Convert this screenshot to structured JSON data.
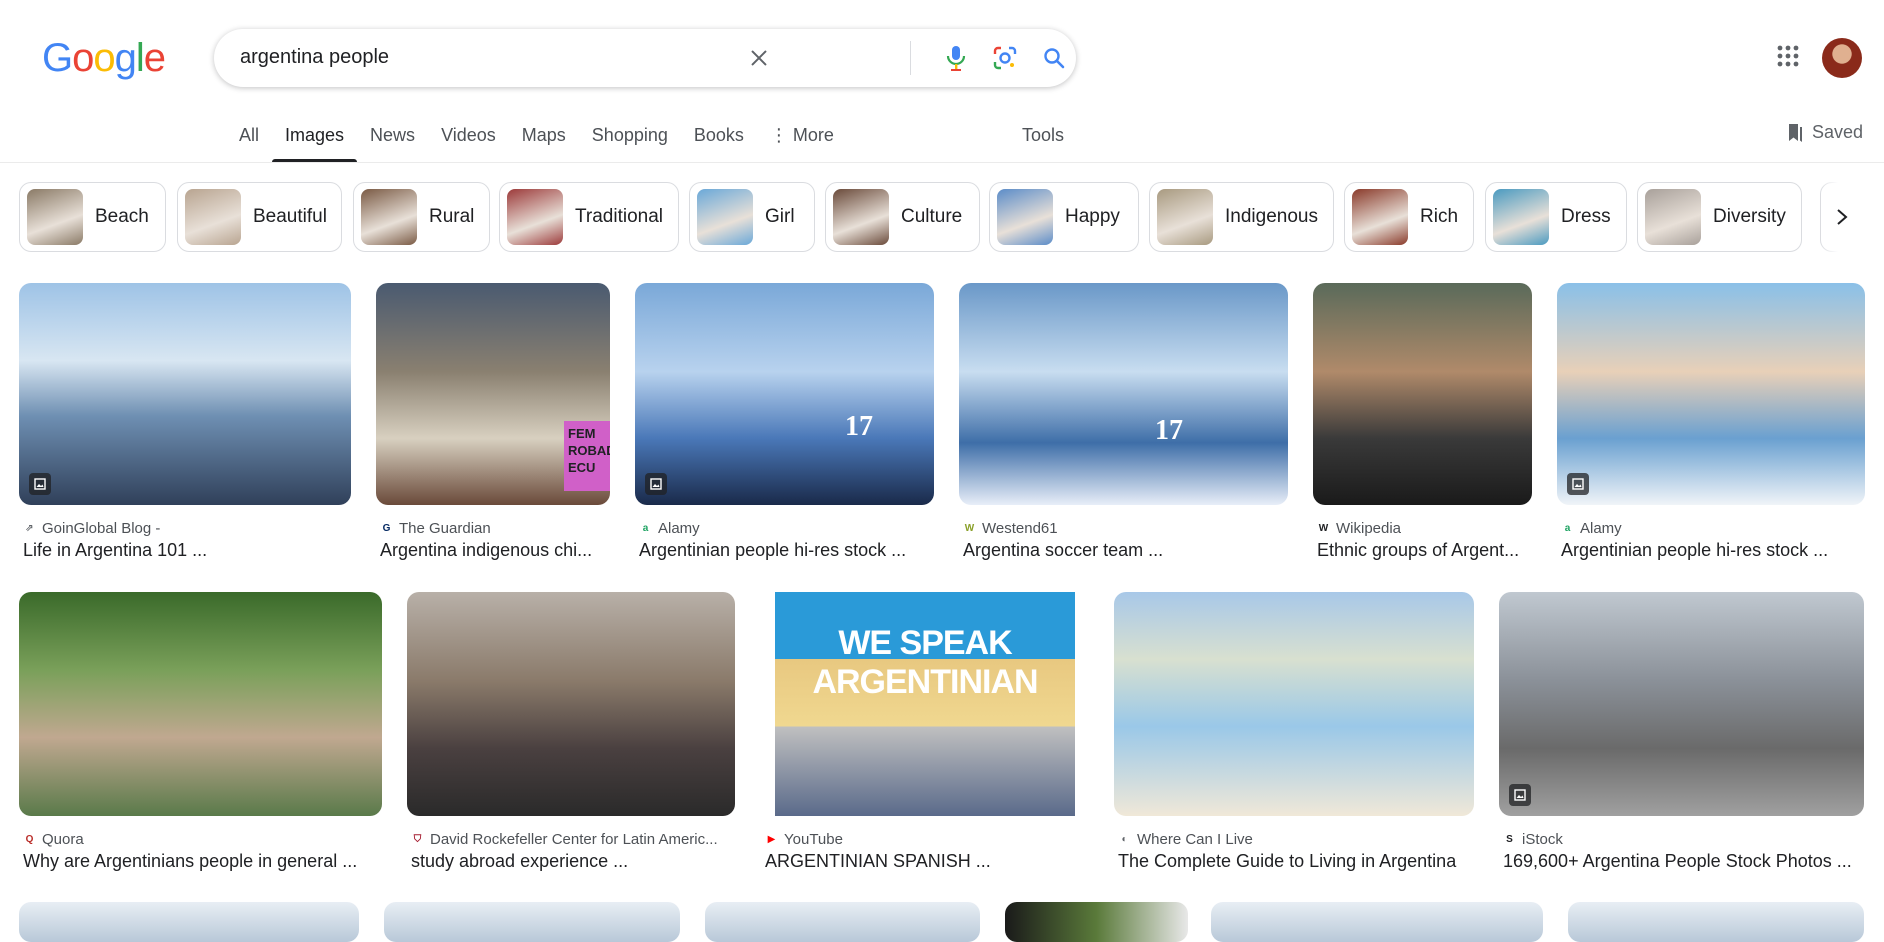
{
  "header": {
    "logo_letters": [
      {
        "ch": "G",
        "color": "#4285F4"
      },
      {
        "ch": "o",
        "color": "#EA4335"
      },
      {
        "ch": "o",
        "color": "#FBBC05"
      },
      {
        "ch": "g",
        "color": "#4285F4"
      },
      {
        "ch": "l",
        "color": "#34A853"
      },
      {
        "ch": "e",
        "color": "#EA4335"
      }
    ],
    "search_query": "argentina people",
    "icons": [
      "close-icon",
      "microphone-icon",
      "lens-icon",
      "search-icon",
      "apps-grid-icon",
      "avatar"
    ]
  },
  "tabs": {
    "items": [
      "All",
      "Images",
      "News",
      "Videos",
      "Maps",
      "Shopping",
      "Books",
      "More"
    ],
    "active": "Images",
    "tools": "Tools",
    "saved": "Saved"
  },
  "chips": [
    {
      "label": "Beach",
      "color": "#8a7a66"
    },
    {
      "label": "Beautiful",
      "color": "#b8a490"
    },
    {
      "label": "Rural",
      "color": "#7a5a44"
    },
    {
      "label": "Traditional",
      "color": "#9c3a3a"
    },
    {
      "label": "Girl",
      "color": "#6aa8d8"
    },
    {
      "label": "Culture",
      "color": "#6a4a3a"
    },
    {
      "label": "Happy",
      "color": "#5b8cc8"
    },
    {
      "label": "Indigenous",
      "color": "#a89a80"
    },
    {
      "label": "Rich",
      "color": "#8a3a2a"
    },
    {
      "label": "Dress",
      "color": "#4a9ac0"
    },
    {
      "label": "Diversity",
      "color": "#a8a09a"
    }
  ],
  "results_row1": [
    {
      "source": "GoinGlobal Blog -",
      "title": "Life in Argentina 101 ...",
      "fav": "⇗",
      "fav_color": "#5f6368",
      "badge": true
    },
    {
      "source": "The Guardian",
      "title": "Argentina indigenous chi...",
      "fav": "G",
      "fav_color": "#052962",
      "badge": false
    },
    {
      "source": "Alamy",
      "title": "Argentinian people hi-res stock ...",
      "fav": "a",
      "fav_color": "#1ea362",
      "badge": true
    },
    {
      "source": "Westend61",
      "title": "Argentina soccer team ...",
      "fav": "W",
      "fav_color": "#8aa02a",
      "badge": false
    },
    {
      "source": "Wikipedia",
      "title": "Ethnic groups of Argent...",
      "fav": "W",
      "fav_color": "#202124",
      "badge": false
    },
    {
      "source": "Alamy",
      "title": "Argentinian people hi-res stock ...",
      "fav": "a",
      "fav_color": "#1ea362",
      "badge": true
    }
  ],
  "results_row2": [
    {
      "source": "Quora",
      "title": "Why are Argentinians people in general ...",
      "fav": "Q",
      "fav_color": "#b92b27",
      "badge": false
    },
    {
      "source": "David Rockefeller Center for Latin Americ...",
      "title": "study abroad experience ...",
      "fav": "⛉",
      "fav_color": "#a51c30",
      "badge": false
    },
    {
      "source": "YouTube",
      "title": "ARGENTINIAN SPANISH ...",
      "fav": "▶",
      "fav_color": "#ff0000",
      "badge": false
    },
    {
      "source": "Where Can I Live",
      "title": "The Complete Guide to Living in Argentina",
      "fav": "◐",
      "fav_color": "#5f6368",
      "badge": false
    },
    {
      "source": "iStock",
      "title": "169,600+ Argentina People Stock Photos ...",
      "fav": "S",
      "fav_color": "#202124",
      "badge": true
    }
  ],
  "thumb_texts": {
    "we_speak": "WE SPEAK ARGENTINIAN",
    "jersey_number": "17",
    "sign_text": "FEM ROBAD ECU"
  }
}
